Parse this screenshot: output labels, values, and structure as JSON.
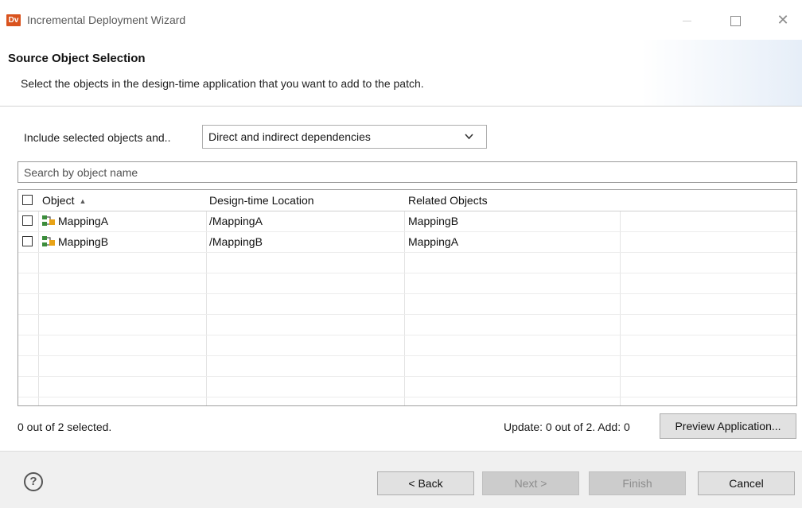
{
  "window": {
    "app_logo_text": "Dv",
    "title": "Incremental Deployment Wizard"
  },
  "header": {
    "title": "Source Object Selection",
    "description": "Select the objects in the design-time application that you want to add to the patch."
  },
  "include": {
    "label": "Include selected objects and..",
    "selected": "Direct and indirect dependencies"
  },
  "search": {
    "placeholder": "Search by object name",
    "value": ""
  },
  "table": {
    "columns": [
      "Object",
      "Design-time Location",
      "Related Objects",
      ""
    ],
    "sort_column": "Object",
    "sort_direction": "ascending",
    "rows": [
      {
        "object": "MappingA",
        "location": "/MappingA",
        "related": "MappingB",
        "checked": false,
        "icon": "mapping-icon"
      },
      {
        "object": "MappingB",
        "location": "/MappingB",
        "related": "MappingA",
        "checked": false,
        "icon": "mapping-icon"
      }
    ]
  },
  "status": {
    "selected_text": "0 out of 2 selected.",
    "update_text": "Update: 0 out of 2. Add: 0",
    "preview_label": "Preview Application..."
  },
  "footer": {
    "back_label": "< Back",
    "next_label": "Next >",
    "finish_label": "Finish",
    "cancel_label": "Cancel"
  },
  "colors": {
    "logo_bg": "#d9531e",
    "button_bg": "#e1e1e1",
    "footer_bg": "#f0f0f0"
  }
}
